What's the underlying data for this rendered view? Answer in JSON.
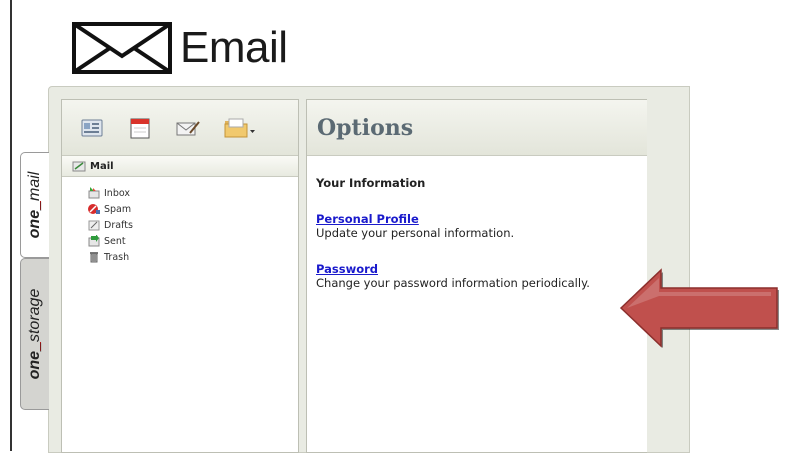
{
  "header": {
    "title": "Email",
    "icon": "envelope-icon"
  },
  "side_tabs": [
    {
      "brand": "one",
      "product": "mail",
      "active": true
    },
    {
      "brand": "one",
      "product": "storage",
      "active": false
    }
  ],
  "toolbar": {
    "icons": [
      "contacts-icon",
      "calendar-icon",
      "compose-icon",
      "folder-menu-icon"
    ]
  },
  "tree": {
    "root_label": "Mail",
    "folders": [
      {
        "label": "Inbox",
        "icon": "inbox-icon"
      },
      {
        "label": "Spam",
        "icon": "spam-icon"
      },
      {
        "label": "Drafts",
        "icon": "drafts-icon"
      },
      {
        "label": "Sent",
        "icon": "sent-icon"
      },
      {
        "label": "Trash",
        "icon": "trash-icon"
      }
    ]
  },
  "options": {
    "heading": "Options",
    "section_title": "Your Information",
    "items": [
      {
        "link": "Personal Profile",
        "description": "Update your personal information."
      },
      {
        "link": "Password",
        "description": "Change your password information periodically."
      }
    ]
  },
  "colors": {
    "link": "#1a1acc",
    "arrow": "#c0504d",
    "heading": "#5b6a73"
  }
}
